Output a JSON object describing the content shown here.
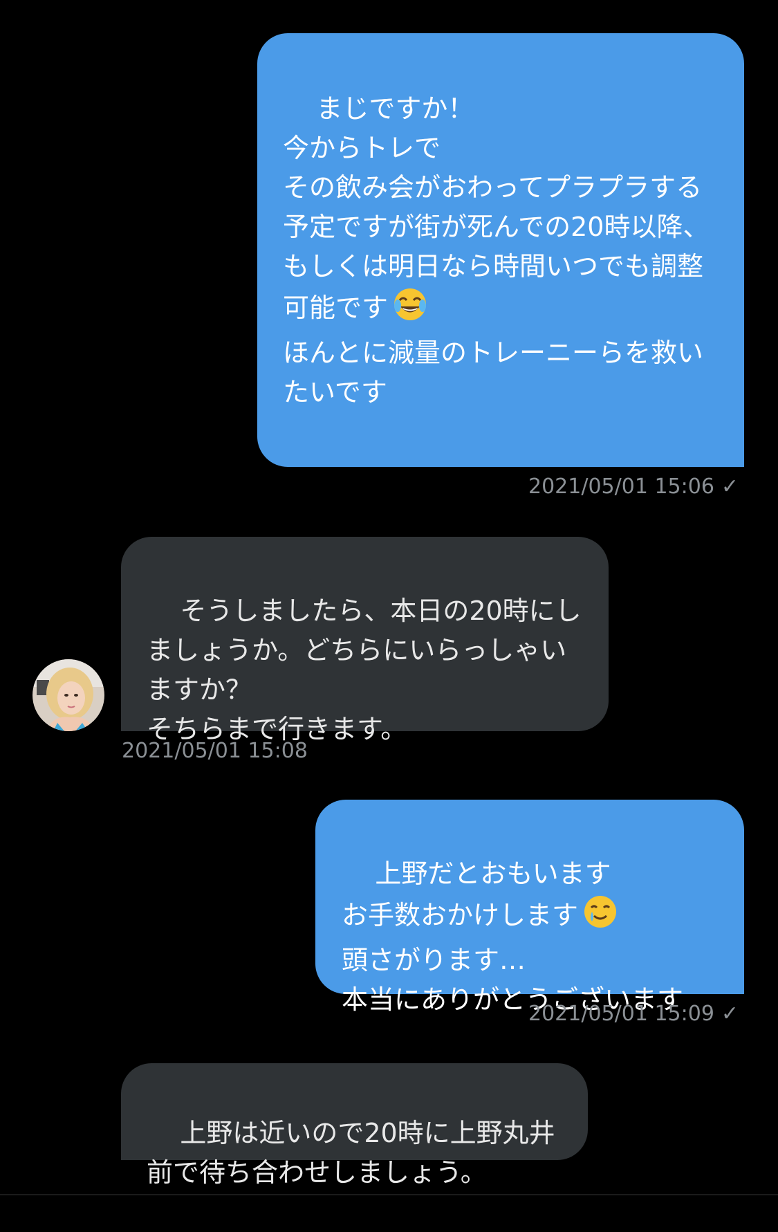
{
  "messages": [
    {
      "direction": "out",
      "text": "まじですか！\n今からトレで\nその飲み会がおわってプラプラする予定ですが街が死んでの20時以降、\nもしくは明日なら時間いつでも調整可能です",
      "emoji": "joy-emoji",
      "text2": "\nほんとに減量のトレーニーらを救いたいです",
      "timestamp": "2021/05/01 15:06",
      "status": "✓"
    },
    {
      "direction": "in",
      "text": "そうしましたら、本日の20時にしましょうか。どちらにいらっしゃいますか？\nそちらまで行きます。",
      "timestamp": "2021/05/01 15:08"
    },
    {
      "direction": "out",
      "text_line1": "上野だとおもいます",
      "text_line2": "お手数おかけします",
      "emoji": "smiling-tear-emoji",
      "text_rest": "頭さがります…\n本当にありがとうございます",
      "timestamp": "2021/05/01 15:09",
      "status": "✓"
    },
    {
      "direction": "in",
      "text": "上野は近いので20時に上野丸井前で待ち合わせしましょう。"
    }
  ],
  "colors": {
    "background": "#000000",
    "outgoing_bubble": "#4b9be8",
    "incoming_bubble": "#2f3336",
    "meta_text": "#8b9095"
  }
}
